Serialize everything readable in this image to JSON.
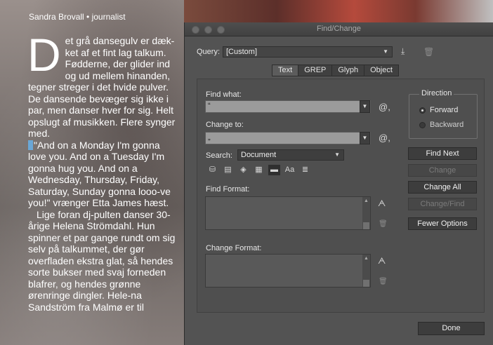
{
  "article": {
    "byline": "Sandra Brovall • journalist",
    "drop_cap": "D",
    "para1_rest": "et grå dansegulv er dæk-ket af et fint lag talkum. Fødderne, der glider ind og ud mellem hinanden, tegner streger i det hvide pulver. De dansende bevæger sig ikke i par, men danser hver for sig. Helt opslugt af musikken. Flere synger med.",
    "para2": "\"And on a Monday I'm gonna love you. And on a Tuesday I'm gonna hug you. And on a Wednesday, Thursday, Friday, Saturday, Sunday gonna looo-ve you!\" vrænger Etta James hæst.",
    "para3": "Lige foran dj-pulten danser 30-årige Helena Strömdahl. Hun spinner et par gange rundt om sig selv på talkummet, der gør overfladen ekstra glat, så hendes sorte bukser med svaj forneden blafrer, og hendes grønne ørenringe dingler. Hele-na Sandström fra Malmø er til"
  },
  "dialog": {
    "title": "Find/Change",
    "query_label": "Query:",
    "query_value": "[Custom]",
    "tabs": [
      "Text",
      "GREP",
      "Glyph",
      "Object"
    ],
    "active_tab": "Text",
    "find_what_label": "Find what:",
    "find_what_value": "“",
    "change_to_label": "Change to:",
    "change_to_value": "„",
    "special_char_icon": "@,",
    "search_label": "Search:",
    "search_value": "Document",
    "option_icons": [
      "locked-layers-icon",
      "locked-stories-icon",
      "hidden-layers-icon",
      "master-pages-icon",
      "footnotes-icon",
      "case-sensitive-icon",
      "whole-word-icon"
    ],
    "find_format_label": "Find Format:",
    "change_format_label": "Change Format:",
    "direction": {
      "title": "Direction",
      "forward": "Forward",
      "backward": "Backward",
      "selected": "Forward"
    },
    "buttons": {
      "find_next": "Find Next",
      "change": "Change",
      "change_all": "Change All",
      "change_find": "Change/Find",
      "fewer_options": "Fewer Options",
      "done": "Done"
    }
  }
}
